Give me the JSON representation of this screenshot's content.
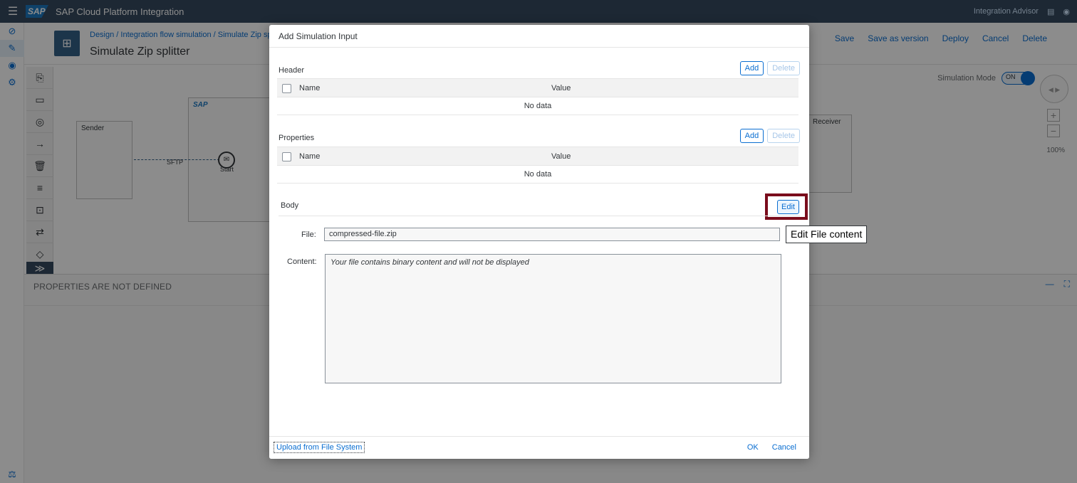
{
  "shell": {
    "logo": "SAP",
    "title": "SAP Cloud Platform Integration",
    "right_label": "Integration Advisor"
  },
  "header": {
    "breadcrumb": "Design / Integration flow simulation / Simulate Zip sp",
    "title": "Simulate Zip splitter",
    "actions": [
      "Save",
      "Save as version",
      "Deploy",
      "Cancel",
      "Delete"
    ]
  },
  "canvas": {
    "sender_label": "Sender",
    "receiver_label": "Receiver",
    "pool_label": "SAP",
    "sftp_label": "SFTP",
    "start_label": "Start",
    "simulation_mode_label": "Simulation Mode",
    "toggle_label": "ON",
    "zoom": "100%"
  },
  "properties": {
    "heading": "PROPERTIES ARE NOT DEFINED"
  },
  "dialog": {
    "title": "Add Simulation Input",
    "header_section": {
      "title": "Header",
      "add": "Add",
      "delete": "Delete",
      "col_name": "Name",
      "col_value": "Value",
      "empty": "No data"
    },
    "properties_section": {
      "title": "Properties",
      "add": "Add",
      "delete": "Delete",
      "col_name": "Name",
      "col_value": "Value",
      "empty": "No data"
    },
    "body_section": {
      "title": "Body",
      "edit": "Edit",
      "file_label": "File:",
      "file_value": "compressed-file.zip",
      "content_label": "Content:",
      "content_value": "Your file contains binary content and will not be displayed"
    },
    "footer": {
      "upload": "Upload from File System",
      "ok": "OK",
      "cancel": "Cancel"
    }
  },
  "tooltip": "Edit File content"
}
